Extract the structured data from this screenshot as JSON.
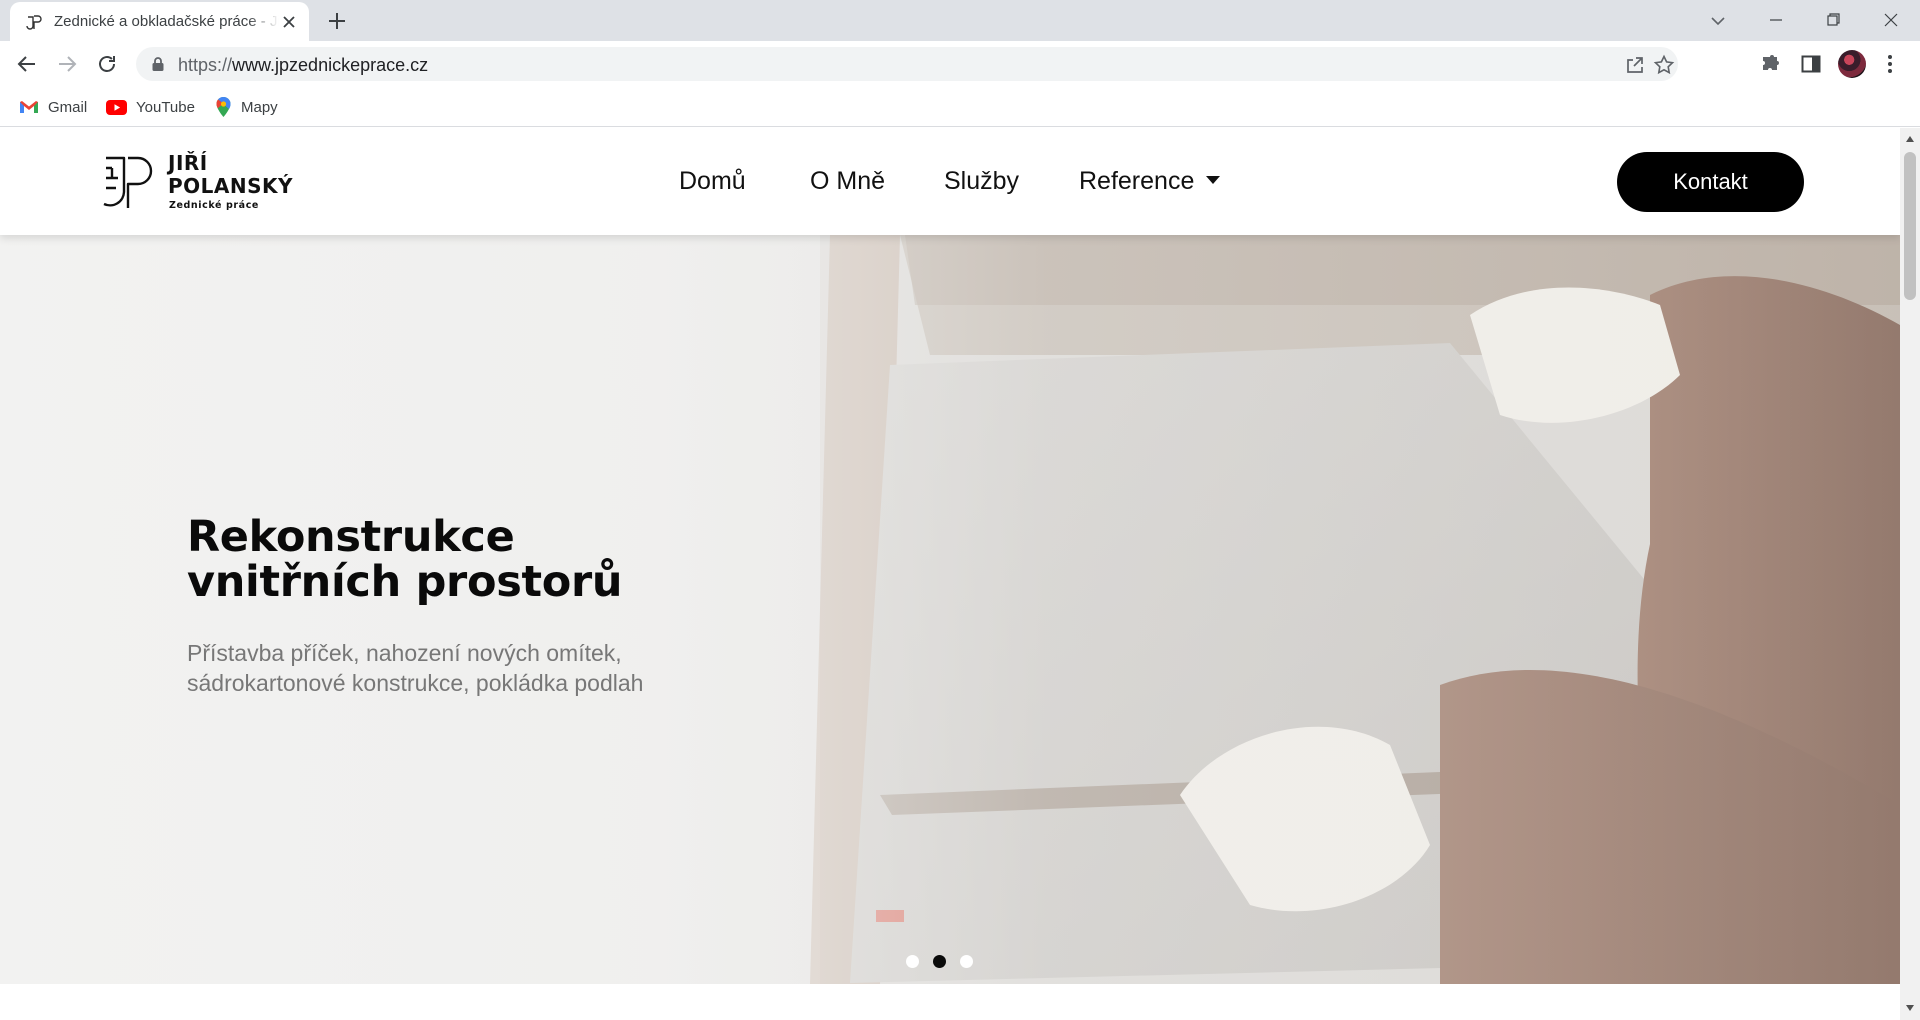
{
  "browser": {
    "tab": {
      "title": "Zednické a obkladačské práce - Jiří Polanský"
    },
    "omnibox": {
      "scheme": "https://",
      "host": "www.jpzednickeprace.cz"
    },
    "bookmarks": [
      {
        "label": "Gmail",
        "icon": "gmail-icon"
      },
      {
        "label": "YouTube",
        "icon": "youtube-icon"
      },
      {
        "label": "Mapy",
        "icon": "maps-icon"
      }
    ]
  },
  "site": {
    "logo": {
      "name_line1": "JIŘÍ",
      "name_line2": "POLANSKÝ",
      "tagline": "Zednické práce"
    },
    "nav": [
      "Domů",
      "O Mně",
      "Služby",
      "Reference"
    ],
    "contact_label": "Kontakt"
  },
  "hero": {
    "title_line1": "Rekonstrukce",
    "title_line2": "vnitřních prostorů",
    "subtitle_line1": "Přístavba příček, nahození nových omítek,",
    "subtitle_line2": "sádrokartonové konstrukce, pokládka podlah",
    "slides_total": 3,
    "active_slide": 2
  },
  "colors": {
    "accent": "#000000",
    "text": "#111111",
    "muted": "#777777"
  }
}
